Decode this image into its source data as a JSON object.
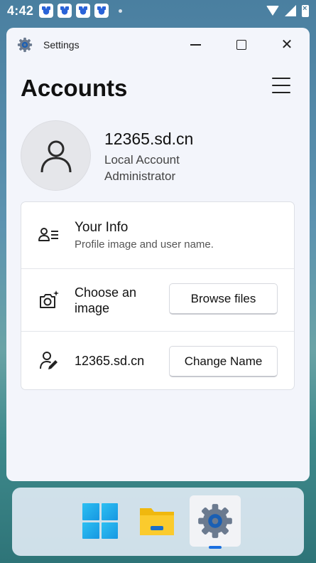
{
  "status_bar": {
    "time": "4:42",
    "notification_icons": [
      "baidu-paw-icon",
      "baidu-paw-icon",
      "baidu-paw-icon",
      "baidu-paw-icon"
    ],
    "system_icons": [
      "wifi-icon",
      "cell-signal-icon",
      "battery-icon"
    ]
  },
  "window": {
    "title": "Settings",
    "controls": [
      "minimize",
      "maximize",
      "close"
    ],
    "close_glyph": "✕"
  },
  "page": {
    "title": "Accounts",
    "menu_icon": "hamburger-menu-icon"
  },
  "account": {
    "name": "12365.sd.cn",
    "type": "Local Account",
    "role": "Administrator"
  },
  "card": {
    "your_info": {
      "title": "Your Info",
      "subtitle": "Profile image and user name."
    },
    "choose_image": {
      "label": "Choose an image",
      "button": "Browse files"
    },
    "change_name": {
      "label": "12365.sd.cn",
      "button": "Change Name"
    }
  },
  "taskbar": {
    "items": [
      "windows-start-icon",
      "file-explorer-icon",
      "settings-gear-icon"
    ],
    "active": "settings-gear-icon"
  },
  "colors": {
    "accent": "#1a6fe0",
    "window_bg": "#f3f5fb"
  }
}
